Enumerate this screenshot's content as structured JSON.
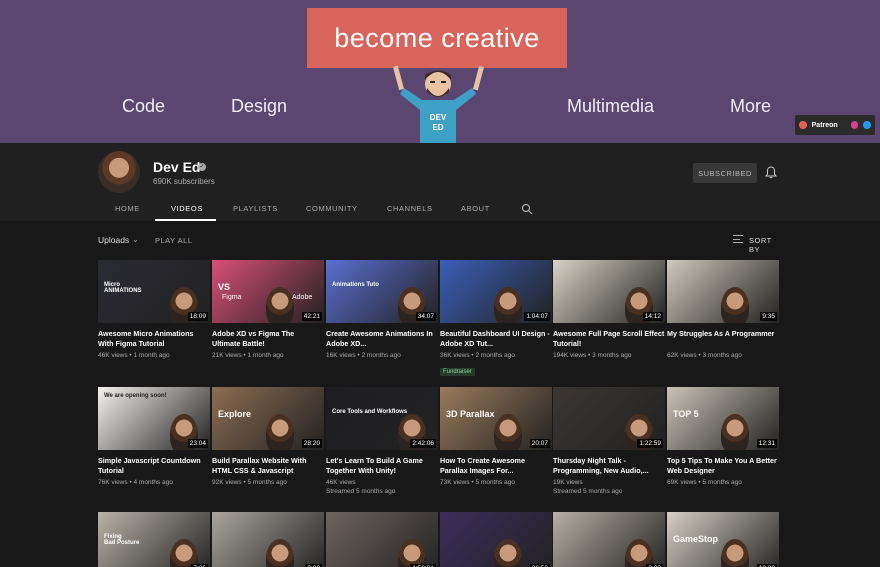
{
  "banner": {
    "title": "become creative",
    "words": [
      "Code",
      "Design",
      "Multimedia",
      "More"
    ],
    "mascot_text": "DEV ED",
    "links": {
      "patreon": "Patreon"
    }
  },
  "channel": {
    "name": "Dev Ed",
    "subscribers": "690K subscribers",
    "subscribe_label": "SUBSCRIBED",
    "tabs": [
      "HOME",
      "VIDEOS",
      "PLAYLISTS",
      "COMMUNITY",
      "CHANNELS",
      "ABOUT"
    ],
    "active_tab": "VIDEOS"
  },
  "controls": {
    "uploads": "Uploads",
    "play_all": "PLAY ALL",
    "sort_by": "SORT BY"
  },
  "videos": [
    {
      "title": "Awesome Micro Animations With Figma Tutorial",
      "views": "46K views",
      "age": "1 month ago",
      "duration": "18:09",
      "thumb_text": "Micro\nANIMATIONS",
      "bg": "#2a2a33"
    },
    {
      "title": "Adobe XD vs Figma The Ultimate Battle!",
      "views": "21K views",
      "age": "1 month ago",
      "duration": "42:21",
      "thumb_text": "VS",
      "sub_left": "Figma",
      "sub_right": "Adobe",
      "bg": "#d84e78"
    },
    {
      "title": "Create Awesome Animations In Adobe XD...",
      "views": "16K views",
      "age": "2 months ago",
      "duration": "34:07",
      "thumb_text": "Animations Tuto",
      "bg": "#5a6fd0"
    },
    {
      "title": "Beautiful Dashboard UI Design - Adobe XD Tut...",
      "views": "36K views",
      "age": "2 months ago",
      "duration": "1:04:07",
      "badge": "Fundraiser",
      "bg": "#3a5fb8"
    },
    {
      "title": "Awesome Full Page Scroll Effect Tutorial!",
      "views": "194K views",
      "age": "3 months ago",
      "duration": "14:12",
      "bg": "#d9d2c4"
    },
    {
      "title": "My Struggles As A Programmer",
      "views": "62K views",
      "age": "3 months ago",
      "duration": "9:35",
      "bg": "#cfc8bb"
    },
    {
      "title": "Simple Javascript Countdown Tutorial",
      "views": "76K views",
      "age": "4 months ago",
      "duration": "23:04",
      "thumb_text": "We are opening soon!",
      "bg": "#f4f1ee"
    },
    {
      "title": "Build Parallax Website With HTML CSS & Javascript",
      "views": "92K views",
      "age": "5 months ago",
      "duration": "28:20",
      "thumb_text": "Explore",
      "bg": "#8b6d52"
    },
    {
      "title": "Let's Learn To Build A Game Together With Unity!",
      "views": "46K views",
      "age": "Streamed 5 months ago",
      "duration": "2:42:06",
      "thumb_text": "Core Tools and Workflows",
      "bg": "#1e1e22"
    },
    {
      "title": "How To Create Awesome Parallax Images For...",
      "views": "73K views",
      "age": "5 months ago",
      "duration": "20:07",
      "thumb_text": "3D Parallax",
      "bg": "#9a7a5c"
    },
    {
      "title": "Thursday Night Talk - Programming, New Audio,...",
      "views": "19K views",
      "age": "Streamed 5 months ago",
      "duration": "1:22:59",
      "bg": "#3b3634"
    },
    {
      "title": "Top 5 Tips To Make You A Better Web Designer",
      "views": "69K views",
      "age": "5 months ago",
      "duration": "12:31",
      "thumb_text": "TOP 5",
      "bg": "#c9c2b6"
    },
    {
      "title": "",
      "views": "",
      "age": "",
      "duration": "7:26",
      "thumb_text": "Fixing\nBad Posture",
      "bg": "#b9b2a8"
    },
    {
      "title": "",
      "views": "",
      "age": "",
      "duration": "9:03",
      "bg": "#a9a49d"
    },
    {
      "title": "",
      "views": "",
      "age": "",
      "duration": "1:50:31",
      "bg": "#6e6460"
    },
    {
      "title": "",
      "views": "",
      "age": "",
      "duration": "26:53",
      "bg": "#3b2d5c"
    },
    {
      "title": "",
      "views": "",
      "age": "",
      "duration": "8:23",
      "bg": "#b7aea3"
    },
    {
      "title": "",
      "views": "",
      "age": "",
      "duration": "10:30",
      "thumb_text": "GameStop",
      "bg": "#d6cfc4"
    }
  ]
}
